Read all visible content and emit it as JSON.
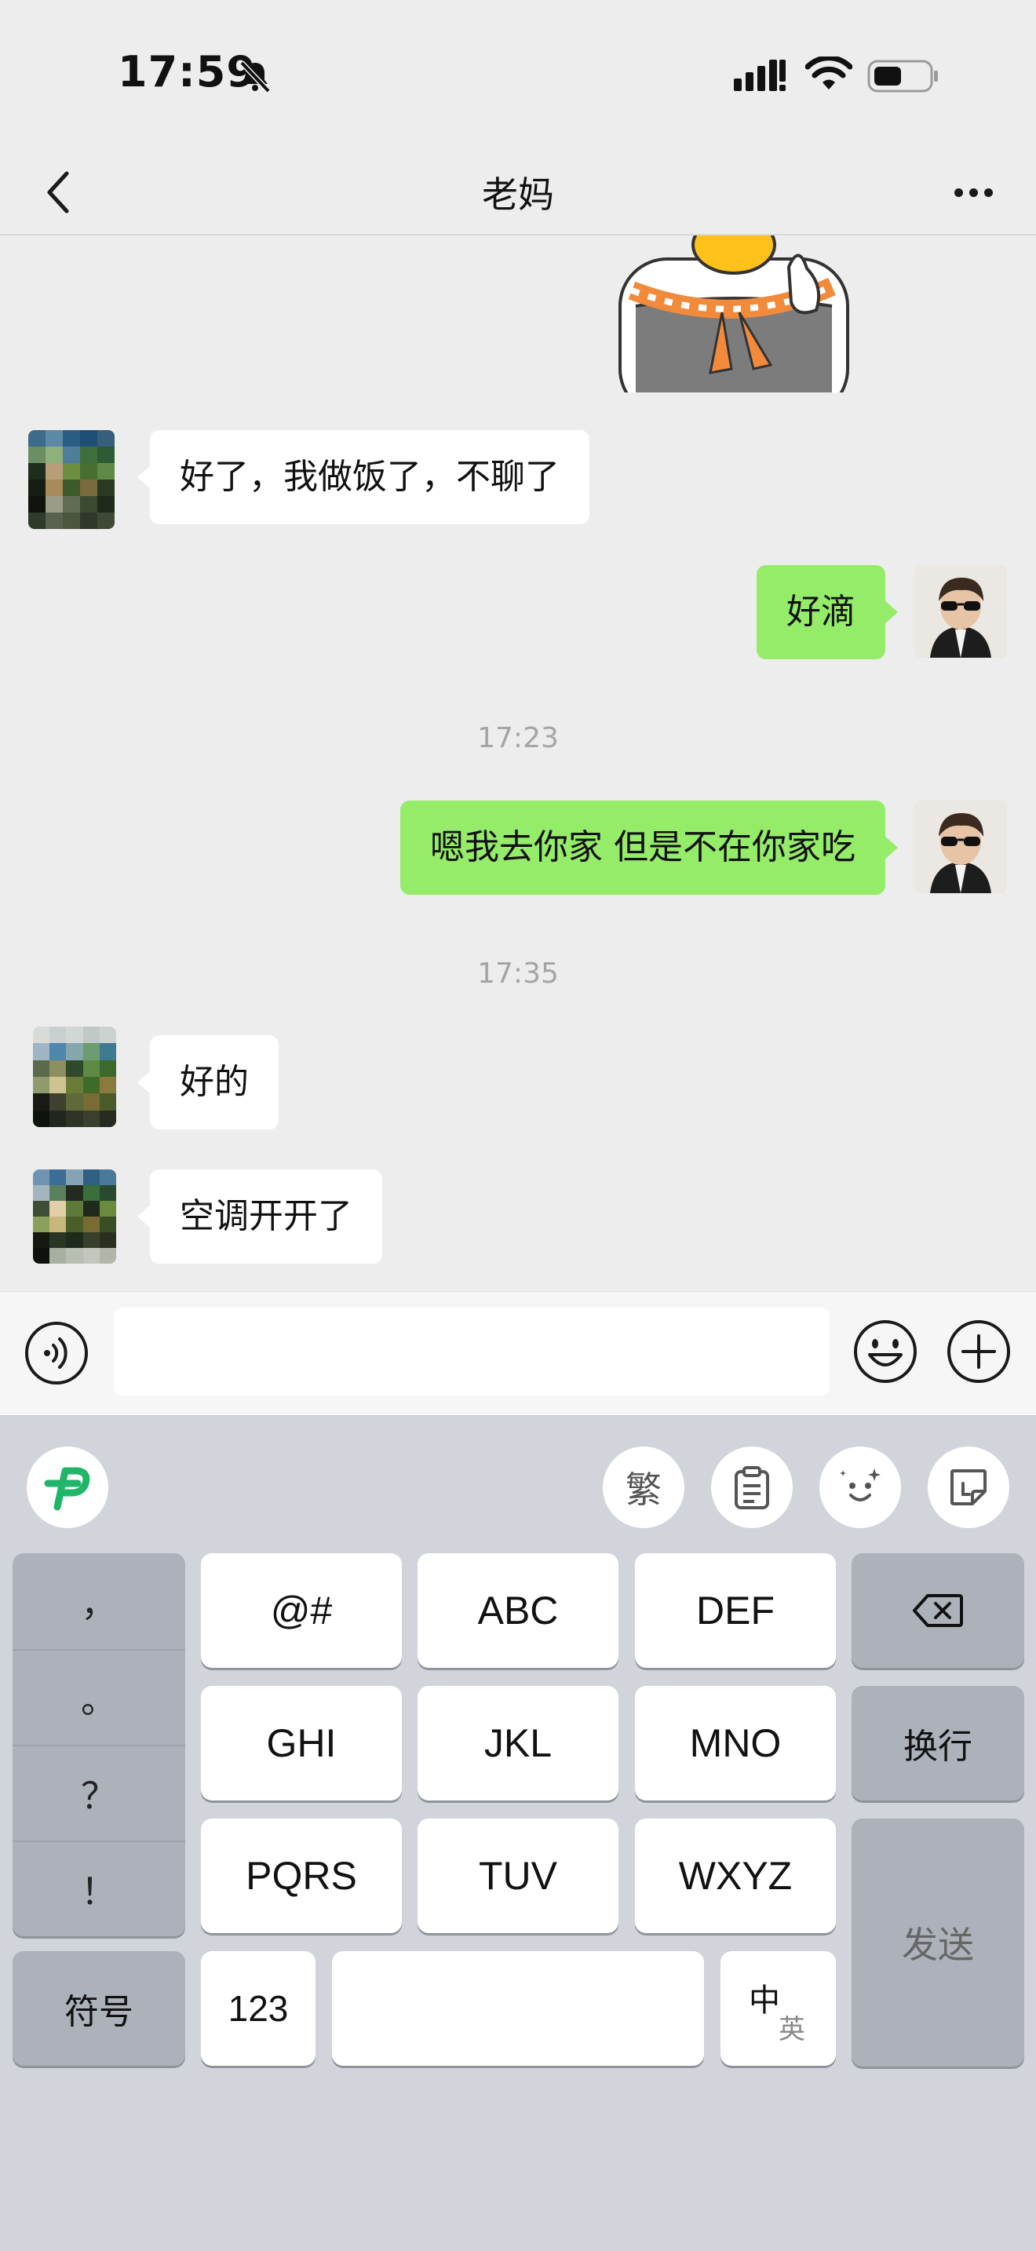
{
  "status_bar": {
    "time": "17:59",
    "icons": [
      "bell-mute-icon",
      "signal-icon",
      "wifi-icon",
      "battery-icon"
    ]
  },
  "nav": {
    "title": "老妈",
    "back_icon": "chevron-left-icon",
    "more_icon": "more-dots-icon"
  },
  "messages": [
    {
      "direction": "in",
      "text": "好了，我做饭了，不聊了"
    },
    {
      "direction": "out",
      "text": "好滴"
    },
    {
      "type": "time",
      "text": "17:23"
    },
    {
      "direction": "out",
      "text": "嗯我去你家 但是不在你家吃"
    },
    {
      "type": "time",
      "text": "17:35"
    },
    {
      "direction": "in",
      "text": "好的"
    },
    {
      "direction": "in",
      "text": "空调开开了"
    }
  ],
  "input_bar": {
    "value": "",
    "icons": [
      "voice-icon",
      "emoji-icon",
      "plus-icon"
    ]
  },
  "keyboard": {
    "toolbar": {
      "traditional_label": "繁",
      "icons": [
        "app-logo-icon",
        "clipboard-icon",
        "sparkle-face-icon",
        "sticker-icon"
      ]
    },
    "punctuation": [
      "，",
      "。",
      "？",
      "！"
    ],
    "keys": {
      "k_at": "@#",
      "k_abc": "ABC",
      "k_def": "DEF",
      "k_ghi": "GHI",
      "k_jkl": "JKL",
      "k_mno": "MNO",
      "k_pqrs": "PQRS",
      "k_tuv": "TUV",
      "k_wxyz": "WXYZ",
      "newline": "换行",
      "symbols": "符号",
      "numbers": "123",
      "space": "",
      "lang_main": "中",
      "lang_alt": "英",
      "send": "发送"
    },
    "colors": {
      "keyboard_bg": "#d1d4db",
      "key_light": "#ffffff",
      "key_dark": "#acb1ba",
      "bubble_out": "#95ec69",
      "bubble_in": "#ffffff",
      "logo_green": "#1fb66a"
    }
  }
}
